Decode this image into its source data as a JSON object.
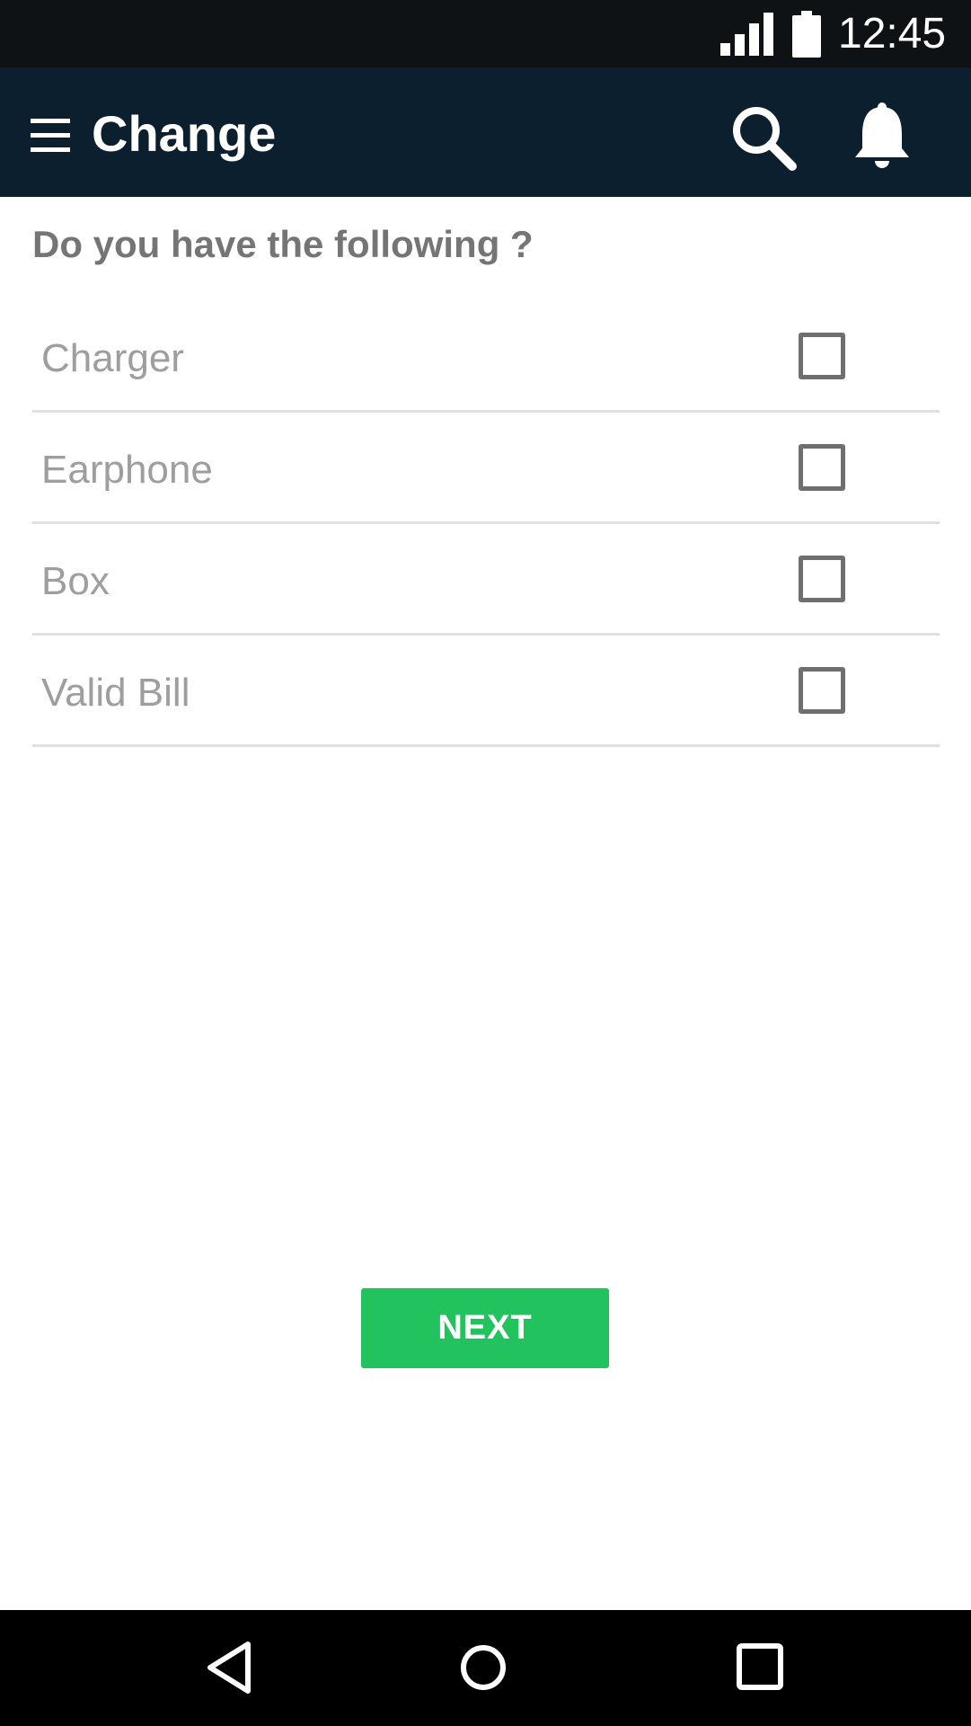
{
  "status_bar": {
    "time": "12:45",
    "icons": [
      "signal-icon",
      "battery-icon"
    ]
  },
  "app_bar": {
    "title": "Change",
    "icons": [
      "menu-icon",
      "search-icon",
      "bell-icon"
    ]
  },
  "question": "Do you have the following ?",
  "checklist": {
    "items": [
      {
        "label": "Charger",
        "checked": false
      },
      {
        "label": "Earphone",
        "checked": false
      },
      {
        "label": "Box",
        "checked": false
      },
      {
        "label": "Valid Bill",
        "checked": false
      }
    ]
  },
  "next_button": {
    "label": "NEXT"
  },
  "nav_bar": {
    "icons": [
      "back-icon",
      "home-icon",
      "recents-icon"
    ]
  },
  "colors": {
    "status_bar": "#0e1214",
    "app_bar": "#0b1f2e",
    "accent": "#22c35e",
    "label_text": "#9e9e9e",
    "question_text": "#757575"
  }
}
